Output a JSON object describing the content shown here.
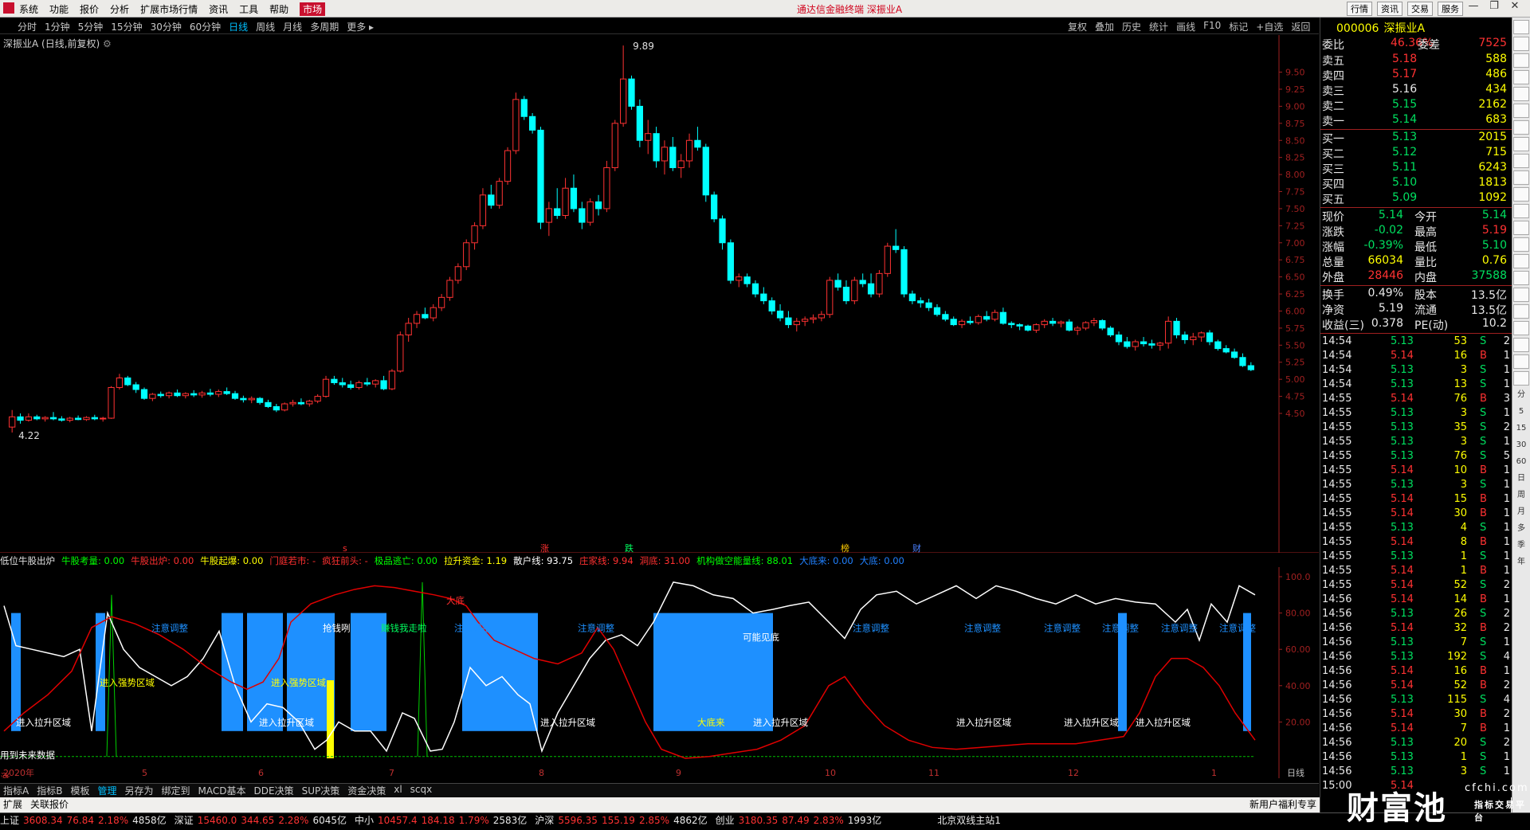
{
  "titlebar": {
    "menus": [
      "系统",
      "功能",
      "报价",
      "分析",
      "扩展市场行情",
      "资讯",
      "工具",
      "帮助",
      "市场"
    ],
    "center": "通达信金融终端  深振业A",
    "right_buttons": [
      "行情",
      "资讯",
      "交易",
      "服务"
    ]
  },
  "periodbar": {
    "items": [
      "分时",
      "1分钟",
      "5分钟",
      "15分钟",
      "30分钟",
      "60分钟",
      "日线",
      "周线",
      "月线",
      "多周期",
      "更多 ▸"
    ],
    "selected": "日线",
    "tools": [
      "复权",
      "叠加",
      "历史",
      "统计",
      "画线",
      "F10",
      "标记",
      "+自选",
      "返回"
    ]
  },
  "chart": {
    "info": "深振业A (日线,前复权)",
    "high_label": "9.89",
    "low_label": "4.22",
    "y_ticks": [
      "9.50",
      "9.25",
      "9.00",
      "8.75",
      "8.50",
      "8.25",
      "8.00",
      "7.75",
      "7.50",
      "7.25",
      "7.00",
      "6.75",
      "6.50",
      "6.25",
      "6.00",
      "5.75",
      "5.50",
      "5.25",
      "5.00",
      "4.75",
      "4.50"
    ],
    "event_marks": [
      "s",
      "涨",
      "跌",
      "榜",
      "财"
    ],
    "candles_ohlc": [
      [
        4.3,
        4.55,
        4.22,
        4.45
      ],
      [
        4.45,
        4.5,
        4.35,
        4.4
      ],
      [
        4.4,
        4.5,
        4.38,
        4.45
      ],
      [
        4.45,
        4.48,
        4.4,
        4.42
      ],
      [
        4.42,
        4.46,
        4.38,
        4.44
      ],
      [
        4.44,
        4.52,
        4.4,
        4.42
      ],
      [
        4.42,
        4.46,
        4.38,
        4.4
      ],
      [
        4.4,
        4.45,
        4.37,
        4.43
      ],
      [
        4.43,
        4.47,
        4.4,
        4.41
      ],
      [
        4.41,
        4.46,
        4.39,
        4.44
      ],
      [
        4.44,
        4.48,
        4.4,
        4.42
      ],
      [
        4.42,
        4.45,
        4.38,
        4.43
      ],
      [
        4.43,
        4.9,
        4.42,
        4.88
      ],
      [
        4.88,
        5.08,
        4.85,
        5.02
      ],
      [
        5.02,
        5.05,
        4.9,
        4.92
      ],
      [
        4.92,
        4.96,
        4.8,
        4.85
      ],
      [
        4.85,
        4.88,
        4.7,
        4.72
      ],
      [
        4.72,
        4.8,
        4.68,
        4.78
      ],
      [
        4.78,
        4.82,
        4.73,
        4.76
      ],
      [
        4.76,
        4.82,
        4.72,
        4.8
      ],
      [
        4.8,
        4.85,
        4.74,
        4.76
      ],
      [
        4.76,
        4.81,
        4.72,
        4.79
      ],
      [
        4.79,
        4.84,
        4.74,
        4.77
      ],
      [
        4.77,
        4.83,
        4.73,
        4.8
      ],
      [
        4.8,
        4.86,
        4.75,
        4.78
      ],
      [
        4.78,
        4.85,
        4.74,
        4.82
      ],
      [
        4.82,
        4.88,
        4.77,
        4.79
      ],
      [
        4.79,
        4.83,
        4.7,
        4.72
      ],
      [
        4.72,
        4.76,
        4.66,
        4.7
      ],
      [
        4.7,
        4.75,
        4.65,
        4.72
      ],
      [
        4.72,
        4.74,
        4.63,
        4.66
      ],
      [
        4.66,
        4.7,
        4.58,
        4.6
      ],
      [
        4.6,
        4.64,
        4.52,
        4.55
      ],
      [
        4.55,
        4.66,
        4.53,
        4.64
      ],
      [
        4.64,
        4.7,
        4.6,
        4.66
      ],
      [
        4.66,
        4.72,
        4.62,
        4.64
      ],
      [
        4.64,
        4.7,
        4.6,
        4.68
      ],
      [
        4.68,
        4.78,
        4.65,
        4.75
      ],
      [
        4.75,
        5.05,
        4.73,
        5.0
      ],
      [
        5.0,
        5.05,
        4.92,
        4.95
      ],
      [
        4.95,
        5.02,
        4.88,
        4.92
      ],
      [
        4.92,
        4.98,
        4.85,
        4.88
      ],
      [
        4.88,
        4.98,
        4.85,
        4.95
      ],
      [
        4.95,
        5.02,
        4.9,
        4.93
      ],
      [
        4.93,
        5.0,
        4.88,
        4.98
      ],
      [
        4.98,
        5.05,
        4.84,
        4.86
      ],
      [
        4.86,
        5.15,
        4.84,
        5.12
      ],
      [
        5.12,
        5.7,
        5.1,
        5.65
      ],
      [
        5.65,
        5.9,
        5.55,
        5.82
      ],
      [
        5.82,
        6.0,
        5.75,
        5.95
      ],
      [
        5.95,
        6.05,
        5.88,
        5.9
      ],
      [
        5.9,
        6.1,
        5.85,
        6.05
      ],
      [
        6.05,
        6.25,
        6.0,
        6.2
      ],
      [
        6.2,
        6.5,
        6.15,
        6.45
      ],
      [
        6.45,
        6.7,
        6.4,
        6.65
      ],
      [
        6.65,
        7.05,
        6.6,
        7.0
      ],
      [
        7.0,
        7.3,
        6.9,
        7.25
      ],
      [
        7.25,
        7.8,
        7.2,
        7.7
      ],
      [
        7.7,
        7.85,
        7.5,
        7.55
      ],
      [
        7.55,
        7.95,
        7.5,
        7.9
      ],
      [
        7.9,
        8.4,
        7.85,
        8.35
      ],
      [
        8.35,
        9.2,
        8.3,
        9.1
      ],
      [
        9.1,
        9.15,
        8.8,
        8.85
      ],
      [
        8.85,
        8.9,
        8.6,
        8.65
      ],
      [
        8.65,
        8.7,
        7.2,
        7.3
      ],
      [
        7.3,
        7.6,
        7.1,
        7.5
      ],
      [
        7.5,
        7.8,
        7.35,
        7.4
      ],
      [
        7.4,
        7.95,
        7.35,
        7.8
      ],
      [
        7.8,
        8.0,
        7.45,
        7.5
      ],
      [
        7.5,
        7.6,
        7.2,
        7.3
      ],
      [
        7.3,
        7.65,
        7.25,
        7.6
      ],
      [
        7.6,
        7.7,
        7.4,
        7.5
      ],
      [
        7.5,
        8.2,
        7.45,
        8.1
      ],
      [
        8.1,
        8.8,
        8.05,
        8.75
      ],
      [
        8.75,
        9.89,
        8.7,
        9.4
      ],
      [
        9.4,
        9.45,
        8.95,
        9.0
      ],
      [
        9.0,
        9.1,
        8.4,
        8.5
      ],
      [
        8.5,
        8.8,
        8.3,
        8.6
      ],
      [
        8.6,
        8.7,
        8.1,
        8.2
      ],
      [
        8.2,
        8.5,
        8.0,
        8.4
      ],
      [
        8.4,
        8.55,
        8.05,
        8.1
      ],
      [
        8.1,
        8.3,
        7.95,
        8.2
      ],
      [
        8.2,
        8.6,
        8.1,
        8.5
      ],
      [
        8.5,
        8.7,
        8.35,
        8.4
      ],
      [
        8.4,
        8.45,
        7.6,
        7.7
      ],
      [
        7.7,
        7.75,
        7.3,
        7.35
      ],
      [
        7.35,
        7.4,
        6.9,
        7.0
      ],
      [
        7.0,
        7.05,
        6.4,
        6.45
      ],
      [
        6.45,
        6.55,
        6.35,
        6.5
      ],
      [
        6.5,
        6.55,
        6.35,
        6.4
      ],
      [
        6.4,
        6.45,
        6.2,
        6.25
      ],
      [
        6.25,
        6.35,
        6.1,
        6.15
      ],
      [
        6.15,
        6.2,
        5.95,
        6.0
      ],
      [
        6.0,
        6.1,
        5.85,
        5.9
      ],
      [
        5.9,
        6.0,
        5.75,
        5.8
      ],
      [
        5.8,
        5.9,
        5.7,
        5.85
      ],
      [
        5.85,
        5.92,
        5.78,
        5.88
      ],
      [
        5.88,
        5.95,
        5.82,
        5.9
      ],
      [
        5.9,
        6.0,
        5.85,
        5.95
      ],
      [
        5.95,
        6.5,
        5.9,
        6.45
      ],
      [
        6.45,
        6.55,
        6.3,
        6.35
      ],
      [
        6.35,
        6.45,
        6.1,
        6.15
      ],
      [
        6.15,
        6.5,
        6.1,
        6.45
      ],
      [
        6.45,
        6.55,
        6.35,
        6.4
      ],
      [
        6.4,
        6.55,
        6.2,
        6.25
      ],
      [
        6.25,
        6.6,
        6.2,
        6.55
      ],
      [
        6.55,
        7.0,
        6.5,
        6.95
      ],
      [
        6.95,
        7.2,
        6.85,
        6.9
      ],
      [
        6.9,
        6.95,
        6.2,
        6.25
      ],
      [
        6.25,
        6.3,
        6.1,
        6.15
      ],
      [
        6.15,
        6.2,
        6.05,
        6.12
      ],
      [
        6.12,
        6.18,
        6.0,
        6.05
      ],
      [
        6.05,
        6.1,
        5.92,
        5.95
      ],
      [
        5.95,
        6.0,
        5.85,
        5.88
      ],
      [
        5.88,
        5.92,
        5.78,
        5.8
      ],
      [
        5.8,
        5.88,
        5.75,
        5.85
      ],
      [
        5.85,
        5.92,
        5.8,
        5.83
      ],
      [
        5.83,
        5.95,
        5.8,
        5.92
      ],
      [
        5.92,
        6.0,
        5.85,
        5.88
      ],
      [
        5.88,
        6.02,
        5.85,
        5.98
      ],
      [
        5.98,
        6.05,
        5.8,
        5.82
      ],
      [
        5.82,
        5.85,
        5.75,
        5.8
      ],
      [
        5.8,
        5.82,
        5.72,
        5.78
      ],
      [
        5.78,
        5.8,
        5.7,
        5.72
      ],
      [
        5.72,
        5.82,
        5.68,
        5.8
      ],
      [
        5.8,
        5.88,
        5.75,
        5.85
      ],
      [
        5.85,
        5.9,
        5.78,
        5.82
      ],
      [
        5.82,
        5.86,
        5.76,
        5.84
      ],
      [
        5.84,
        5.88,
        5.7,
        5.72
      ],
      [
        5.72,
        5.78,
        5.65,
        5.75
      ],
      [
        5.75,
        5.85,
        5.72,
        5.83
      ],
      [
        5.83,
        5.9,
        5.78,
        5.86
      ],
      [
        5.86,
        5.88,
        5.72,
        5.75
      ],
      [
        5.75,
        5.78,
        5.62,
        5.65
      ],
      [
        5.65,
        5.7,
        5.5,
        5.55
      ],
      [
        5.55,
        5.62,
        5.45,
        5.48
      ],
      [
        5.48,
        5.58,
        5.42,
        5.55
      ],
      [
        5.55,
        5.62,
        5.48,
        5.52
      ],
      [
        5.52,
        5.58,
        5.45,
        5.5
      ],
      [
        5.5,
        5.55,
        5.42,
        5.53
      ],
      [
        5.53,
        5.92,
        5.45,
        5.85
      ],
      [
        5.85,
        5.9,
        5.6,
        5.65
      ],
      [
        5.65,
        5.7,
        5.52,
        5.58
      ],
      [
        5.58,
        5.68,
        5.5,
        5.62
      ],
      [
        5.62,
        5.7,
        5.55,
        5.68
      ],
      [
        5.68,
        5.72,
        5.5,
        5.55
      ],
      [
        5.55,
        5.58,
        5.42,
        5.45
      ],
      [
        5.45,
        5.5,
        5.38,
        5.4
      ],
      [
        5.4,
        5.45,
        5.3,
        5.32
      ],
      [
        5.32,
        5.38,
        5.18,
        5.2
      ],
      [
        5.2,
        5.25,
        5.12,
        5.14
      ]
    ]
  },
  "indicator": {
    "name": "低位牛股出炉",
    "fields": [
      {
        "label": "牛股考量: 0.00",
        "color": "#00ff00"
      },
      {
        "label": "牛股出炉: 0.00",
        "color": "#ff3030"
      },
      {
        "label": "牛股起爆: 0.00",
        "color": "#ffff00"
      },
      {
        "label": "门庭若市: -",
        "color": "#ff3030"
      },
      {
        "label": "疯狂前头: -",
        "color": "#ff3030"
      },
      {
        "label": "极品逃亡: 0.00",
        "color": "#00ff00"
      },
      {
        "label": "拉升资金: 1.19",
        "color": "#ffff00"
      },
      {
        "label": "散户线: 93.75",
        "color": "#ffffff"
      },
      {
        "label": "庄家线: 9.94",
        "color": "#ff3030"
      },
      {
        "label": "洞底: 31.00",
        "color": "#ff3030"
      },
      {
        "label": "机构做空能量线: 88.01",
        "color": "#00ff00"
      },
      {
        "label": "大底来: 0.00",
        "color": "#2080ff"
      },
      {
        "label": "大底: 0.00",
        "color": "#2080ff"
      }
    ],
    "y_ticks": [
      "100.0",
      "80.00",
      "60.00",
      "40.00",
      "20.00"
    ],
    "annotations": [
      "注意调整",
      "注意调整",
      "注意调整",
      "注意调整",
      "注意调整",
      "注意调整",
      "注意调整",
      "注意调整",
      "注意调整",
      "抢钱咧",
      "赚钱我走啦",
      "可能见底",
      "进入强势区域",
      "进入强势区域",
      "进入拉升区域",
      "进入拉升区域",
      "进入拉升区域",
      "进入拉升区域",
      "进入拉升区域",
      "进入拉升区域",
      "进入拉升区域",
      "大底来",
      "大底",
      "涨",
      "用到未来数据"
    ],
    "months": [
      "2020年",
      "5",
      "6",
      "7",
      "8",
      "9",
      "10",
      "11",
      "12",
      "1"
    ],
    "period_label": "日线"
  },
  "bottom_tabs": [
    "指标A",
    "指标B",
    "模板",
    "管理",
    "另存为",
    "绑定到",
    "MACD基本",
    "DDE决策",
    "SUP决策",
    "资金决策",
    "xl",
    "scqx"
  ],
  "bottom_tabs_selected": "管理",
  "sub_tabs": [
    "扩展",
    "关联报价"
  ],
  "sub_right": "新用户福利专享",
  "statusbar": [
    {
      "name": "上证",
      "price": "3608.34",
      "chg": "76.84",
      "pct": "2.18%",
      "vol": "4858亿",
      "dir": "up"
    },
    {
      "name": "深证",
      "price": "15460.0",
      "chg": "344.65",
      "pct": "2.28%",
      "vol": "6045亿",
      "dir": "up"
    },
    {
      "name": "中小",
      "price": "10457.4",
      "chg": "184.18",
      "pct": "1.79%",
      "vol": "2583亿",
      "dir": "up"
    },
    {
      "name": "沪深",
      "price": "5596.35",
      "chg": "155.19",
      "pct": "2.85%",
      "vol": "4862亿",
      "dir": "up"
    },
    {
      "name": "创业",
      "price": "3180.35",
      "chg": "87.49",
      "pct": "2.83%",
      "vol": "1993亿",
      "dir": "up"
    }
  ],
  "status_right": "北京双线主站1",
  "quote": {
    "code": "000006",
    "name": "深振业A",
    "weibi_label": "委比",
    "weibi": "46.36%",
    "weicha_label": "委差",
    "weicha": "7525",
    "asks": [
      {
        "label": "卖五",
        "price": "5.18",
        "vol": "588"
      },
      {
        "label": "卖四",
        "price": "5.17",
        "vol": "486"
      },
      {
        "label": "卖三",
        "price": "5.16",
        "vol": "434"
      },
      {
        "label": "卖二",
        "price": "5.15",
        "vol": "2162"
      },
      {
        "label": "卖一",
        "price": "5.14",
        "vol": "683"
      }
    ],
    "bids": [
      {
        "label": "买一",
        "price": "5.13",
        "vol": "2015"
      },
      {
        "label": "买二",
        "price": "5.12",
        "vol": "715"
      },
      {
        "label": "买三",
        "price": "5.11",
        "vol": "6243"
      },
      {
        "label": "买四",
        "price": "5.10",
        "vol": "1813"
      },
      {
        "label": "买五",
        "price": "5.09",
        "vol": "1092"
      }
    ],
    "stats": [
      [
        "现价",
        "5.14",
        "今开",
        "5.14"
      ],
      [
        "涨跌",
        "-0.02",
        "最高",
        "5.19"
      ],
      [
        "涨幅",
        "-0.39%",
        "最低",
        "5.10"
      ],
      [
        "总量",
        "66034",
        "量比",
        "0.76"
      ],
      [
        "外盘",
        "28446",
        "内盘",
        "37588"
      ]
    ],
    "stats2": [
      [
        "换手",
        "0.49%",
        "股本",
        "13.5亿"
      ],
      [
        "净资",
        "5.19",
        "流通",
        "13.5亿"
      ],
      [
        "收益(三)",
        "0.378",
        "PE(动)",
        "10.2"
      ]
    ],
    "ticks": [
      [
        "14:54",
        "5.13",
        "53",
        "S",
        "2"
      ],
      [
        "14:54",
        "5.14",
        "16",
        "B",
        "1"
      ],
      [
        "14:54",
        "5.13",
        "3",
        "S",
        "1"
      ],
      [
        "14:54",
        "5.13",
        "13",
        "S",
        "1"
      ],
      [
        "14:55",
        "5.14",
        "76",
        "B",
        "3"
      ],
      [
        "14:55",
        "5.13",
        "3",
        "S",
        "1"
      ],
      [
        "14:55",
        "5.13",
        "35",
        "S",
        "2"
      ],
      [
        "14:55",
        "5.13",
        "3",
        "S",
        "1"
      ],
      [
        "14:55",
        "5.13",
        "76",
        "S",
        "5"
      ],
      [
        "14:55",
        "5.14",
        "10",
        "B",
        "1"
      ],
      [
        "14:55",
        "5.13",
        "3",
        "S",
        "1"
      ],
      [
        "14:55",
        "5.14",
        "15",
        "B",
        "1"
      ],
      [
        "14:55",
        "5.14",
        "30",
        "B",
        "1"
      ],
      [
        "14:55",
        "5.13",
        "4",
        "S",
        "1"
      ],
      [
        "14:55",
        "5.14",
        "8",
        "B",
        "1"
      ],
      [
        "14:55",
        "5.13",
        "1",
        "S",
        "1"
      ],
      [
        "14:55",
        "5.14",
        "1",
        "B",
        "1"
      ],
      [
        "14:55",
        "5.14",
        "52",
        "S",
        "2"
      ],
      [
        "14:56",
        "5.14",
        "14",
        "B",
        "1"
      ],
      [
        "14:56",
        "5.13",
        "26",
        "S",
        "2"
      ],
      [
        "14:56",
        "5.14",
        "32",
        "B",
        "2"
      ],
      [
        "14:56",
        "5.13",
        "7",
        "S",
        "1"
      ],
      [
        "14:56",
        "5.13",
        "192",
        "S",
        "4"
      ],
      [
        "14:56",
        "5.14",
        "16",
        "B",
        "1"
      ],
      [
        "14:56",
        "5.14",
        "52",
        "B",
        "2"
      ],
      [
        "14:56",
        "5.13",
        "115",
        "S",
        "4"
      ],
      [
        "14:56",
        "5.14",
        "30",
        "B",
        "2"
      ],
      [
        "14:56",
        "5.14",
        "7",
        "B",
        "1"
      ],
      [
        "14:56",
        "5.13",
        "20",
        "S",
        "2"
      ],
      [
        "14:56",
        "5.13",
        "1",
        "S",
        "1"
      ],
      [
        "14:56",
        "5.13",
        "3",
        "S",
        "1"
      ],
      [
        "15:00",
        "5.14",
        "",
        "",
        " "
      ]
    ]
  },
  "sidebar": [
    "分",
    "5",
    "15",
    "30",
    "60",
    "日",
    "周",
    "月",
    "多",
    "季",
    "年"
  ],
  "logo": {
    "text": "财富池",
    "domain": "cfchi.com",
    "sub": "指标交易平台"
  }
}
